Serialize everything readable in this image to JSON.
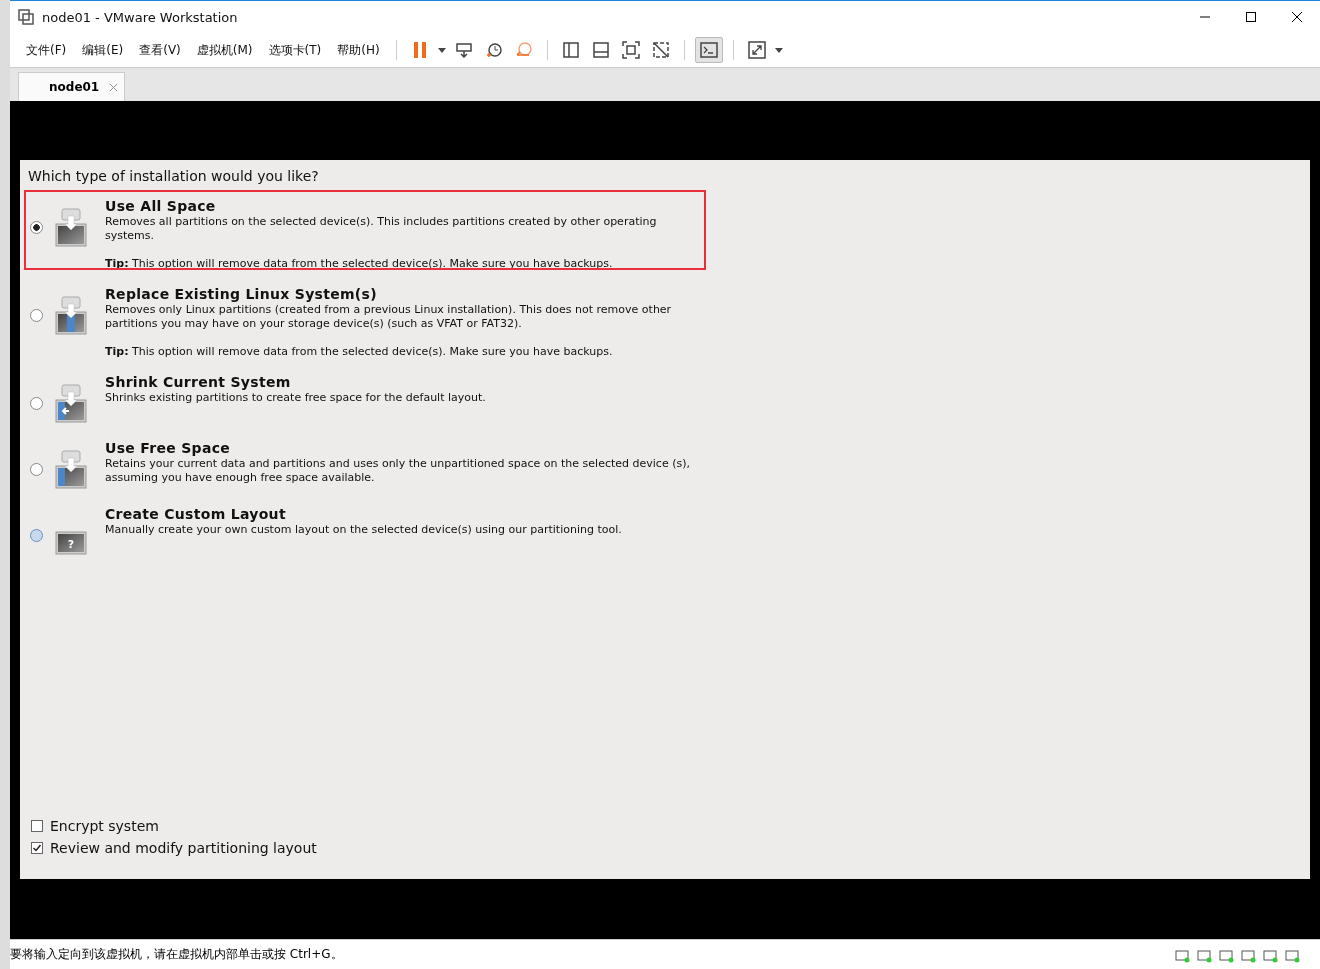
{
  "window": {
    "title": "node01 - VMware Workstation"
  },
  "menu": [
    "文件(F)",
    "编辑(E)",
    "查看(V)",
    "虚拟机(M)",
    "选项卡(T)",
    "帮助(H)"
  ],
  "tabs": [
    {
      "label": "node01",
      "selected": true
    }
  ],
  "installer": {
    "question": "Which type of installation would you like?",
    "options": [
      {
        "kind": "all",
        "title": "Use All Space",
        "description": "Removes all partitions on the selected device(s).  This includes partitions created by other operating systems.",
        "tip": "**Tip:** This option will remove data from the selected device(s).  Make sure you have backups.",
        "selected": true,
        "highlighted": false,
        "annotated": true
      },
      {
        "kind": "linux",
        "title": "Replace Existing Linux System(s)",
        "description": "Removes only Linux partitions (created from a previous Linux installation).  This does not remove other partitions you may have on your storage device(s) (such as VFAT or FAT32).",
        "tip": "**Tip:** This option will remove data from the selected device(s).  Make sure you have backups.",
        "selected": false,
        "highlighted": false,
        "annotated": false
      },
      {
        "kind": "shrink",
        "title": "Shrink Current System",
        "description": "Shrinks existing partitions to create free space for the default layout.",
        "selected": false,
        "highlighted": false,
        "annotated": false
      },
      {
        "kind": "free",
        "title": "Use Free Space",
        "description": "Retains your current data and partitions and uses only the unpartitioned space on the selected device (s), assuming you have enough free space available.",
        "selected": false,
        "highlighted": false,
        "annotated": false
      },
      {
        "kind": "custom",
        "title": "Create Custom Layout",
        "description": "Manually create your own custom layout on the selected device(s) using our partitioning tool.",
        "icon_glyph": "?",
        "selected": false,
        "highlighted": true,
        "annotated": false
      }
    ],
    "checkboxes": [
      {
        "label": "Encrypt system",
        "checked": false
      },
      {
        "label": "Review and modify partitioning layout",
        "checked": true
      }
    ]
  },
  "status_bar": {
    "message": "要将输入定向到该虚拟机，请在虚拟机内部单击或按 Ctrl+G。"
  }
}
